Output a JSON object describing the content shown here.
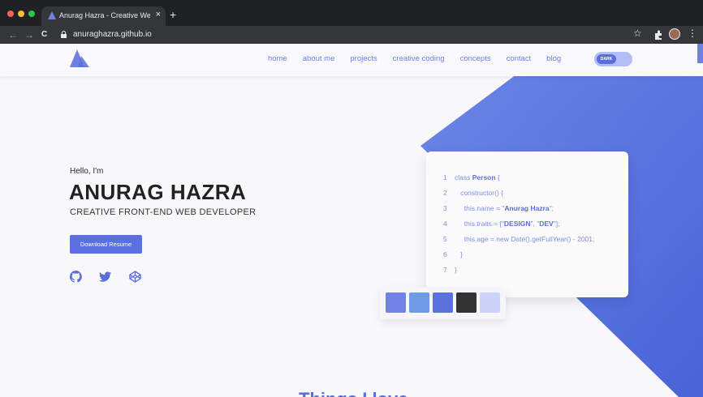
{
  "browser": {
    "tab_title": "Anurag Hazra - Creative Web D",
    "tab_close": "×",
    "new_tab": "+",
    "back": "←",
    "forward": "→",
    "reload": "C",
    "url": "anuraghazra.github.io",
    "bookmark": "☆",
    "menu": "⋮"
  },
  "nav": {
    "links": [
      "home",
      "about me",
      "projects",
      "creative coding",
      "concepts",
      "contact",
      "blog"
    ],
    "toggle_label": "DARK"
  },
  "hero": {
    "greeting": "Hello, I'm",
    "name": "ANURAG HAZRA",
    "role": "CREATIVE FRONT-END WEB DEVELOPER",
    "resume_button": "Download Resume"
  },
  "code": {
    "lines": [
      {
        "n": "1",
        "pre": "class ",
        "kw": "Person",
        "post": " {"
      },
      {
        "n": "2",
        "pre": "   constructor() {",
        "kw": "",
        "post": ""
      },
      {
        "n": "3",
        "pre": "     this.name = \"",
        "kw": "Anurag Hazra",
        "post": "\";"
      },
      {
        "n": "4",
        "pre": "     this.traits = [\"",
        "kw": "DESIGN",
        "post": "\", \""
      },
      {
        "n": "5",
        "pre": "     this.age = new Date().getFullYear() - 2001;",
        "kw": "",
        "post": ""
      },
      {
        "n": "6",
        "pre": "   }",
        "kw": "",
        "post": ""
      },
      {
        "n": "7",
        "pre": "}",
        "kw": "",
        "post": ""
      }
    ],
    "line4_kw2": "DEV",
    "line4_end": "\"];"
  },
  "palette": [
    "#7182e8",
    "#6d9be6",
    "#5a72de",
    "#333333",
    "#cdd3f8"
  ],
  "colors": {
    "accent": "#5a6ed9",
    "shape": "#5b74e0"
  },
  "section_title": "Things I love"
}
